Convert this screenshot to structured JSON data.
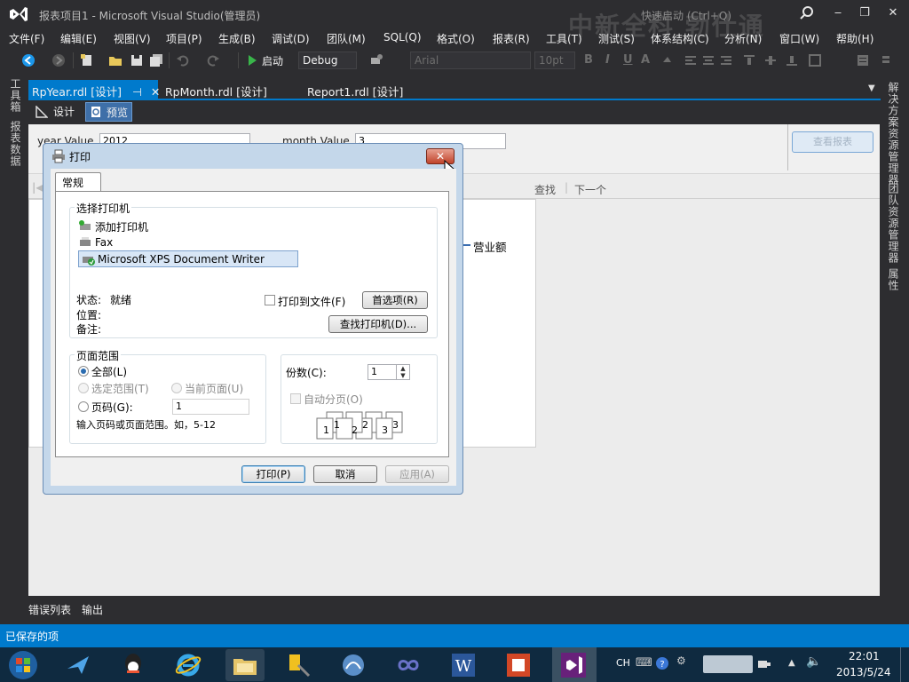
{
  "window": {
    "title": "报表项目1 - Microsoft Visual Studio(管理员)",
    "quick_launch_placeholder": "快速启动 (Ctrl+Q)",
    "watermark": "中新全科 勃仕通",
    "controls": {
      "minimize": "‒",
      "maximize": "❐",
      "close": "✕"
    }
  },
  "menu": [
    "文件(F)",
    "编辑(E)",
    "视图(V)",
    "项目(P)",
    "生成(B)",
    "调试(D)",
    "团队(M)",
    "SQL(Q)",
    "格式(O)",
    "报表(R)",
    "工具(T)",
    "测试(S)",
    "体系结构(C)",
    "分析(N)",
    "窗口(W)",
    "帮助(H)"
  ],
  "toolbar": {
    "start_label": "启动",
    "config": "Debug",
    "font": "Arial",
    "font_size": "10pt",
    "glyphs": {
      "bold": "B",
      "italic": "I",
      "underline": "U",
      "color": "A"
    }
  },
  "left_rail": {
    "toolbox": "工具箱",
    "report_data": "报表数据"
  },
  "right_rail": {
    "solution_explorer": "解决方案资源管理器",
    "team_explorer": "团队资源管理器",
    "properties": "属性"
  },
  "doc_tabs": [
    {
      "label": "RpYear.rdl [设计]",
      "active": true
    },
    {
      "label": "RpMonth.rdl [设计]",
      "active": false
    },
    {
      "label": "Report1.rdl [设计]",
      "active": false
    }
  ],
  "sub_tabs": {
    "design": "设计",
    "preview": "预览"
  },
  "params": {
    "year_label": "year Value",
    "year_value": "2012",
    "month_label": "month Value",
    "month_value": "3",
    "view_button": "查看报表"
  },
  "report_toolbar": {
    "find": "查找",
    "next": "下一个"
  },
  "report": {
    "legend_label": "营业额"
  },
  "bottom_tabs": [
    "错误列表",
    "输出"
  ],
  "status": "已保存的项",
  "taskbar": {
    "ime": "CH",
    "time": "22:01",
    "date": "2013/5/24"
  },
  "print_dialog": {
    "title": "打印",
    "tab": "常规",
    "printer_group": "选择打印机",
    "printers": [
      {
        "name": "添加打印机",
        "icon": "add-printer-icon",
        "selected": false
      },
      {
        "name": "Fax",
        "icon": "fax-printer-icon",
        "selected": false
      },
      {
        "name": "Microsoft XPS Document Writer",
        "icon": "default-printer-icon",
        "selected": true
      }
    ],
    "status_label": "状态:",
    "status_value": "就绪",
    "location_label": "位置:",
    "comment_label": "备注:",
    "print_to_file": "打印到文件(F)",
    "preferences_button": "首选项(R)",
    "find_printer_button": "查找打印机(D)...",
    "range_group": "页面范围",
    "range_all": "全部(L)",
    "range_selection": "选定范围(T)",
    "range_current": "当前页面(U)",
    "range_pages": "页码(G):",
    "pages_value": "1",
    "pages_hint": "输入页码或页面范围。如，5-12",
    "copies_label": "份数(C):",
    "copies_value": "1",
    "collate": "自动分页(O)",
    "collate_digits": [
      "1",
      "1",
      "2",
      "2",
      "3",
      "3"
    ],
    "print_button": "打印(P)",
    "cancel_button": "取消",
    "apply_button": "应用(A)"
  }
}
